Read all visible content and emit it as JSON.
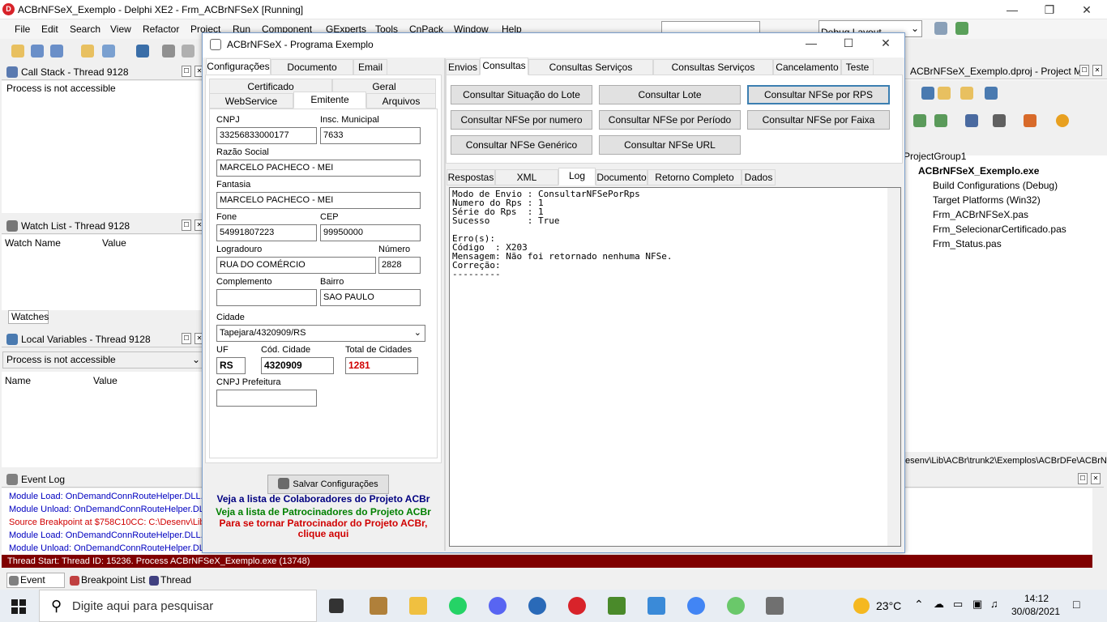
{
  "ide": {
    "title": "ACBrNFSeX_Exemplo - Delphi XE2 - Frm_ACBrNFSeX [Running]",
    "menu": [
      "File",
      "Edit",
      "Search",
      "View",
      "Refactor",
      "Project",
      "Run",
      "Component",
      "GExperts",
      "Tools",
      "CnPack",
      "Window",
      "Help"
    ],
    "layout_combo": "Debug Layout",
    "call_stack": {
      "title": "Call Stack - Thread 9128",
      "text": "Process is not accessible"
    },
    "watch_list": {
      "title": "Watch List - Thread 9128",
      "col_name": "Watch Name",
      "col_value": "Value",
      "tab": "Watches"
    },
    "local_vars": {
      "title": "Local Variables - Thread 9128",
      "combo": "Process is not accessible",
      "col_name": "Name",
      "col_value": "Value"
    },
    "project_manager": {
      "title": "ACBrNFSeX_Exemplo.dproj - Project M...",
      "group": "ProjectGroup1",
      "project": "ACBrNFSeX_Exemplo.exe",
      "items": [
        "Build Configurations (Debug)",
        "Target Platforms (Win32)",
        "Frm_ACBrNFSeX.pas",
        "Frm_SelecionarCertificado.pas",
        "Frm_Status.pas"
      ],
      "path": "esenv\\Lib\\ACBr\\trunk2\\Exemplos\\ACBrDFe\\ACBrNFS"
    },
    "event_log": {
      "title": "Event Log",
      "lines": [
        {
          "text": "Module Load: OnDemandConnRouteHelper.DLL. N",
          "color": "#0000c0"
        },
        {
          "text": "Module Unload: OnDemandConnRouteHelper.DLL.",
          "color": "#0000c0"
        },
        {
          "text": "Source Breakpoint at $758C10CC: C:\\Desenv\\Lib\\",
          "color": "#d00000"
        },
        {
          "text": "Module Load: OnDemandConnRouteHelper.DLL. N",
          "color": "#0000c0"
        },
        {
          "text": "Module Unload: OnDemandConnRouteHelper.DLL.",
          "color": "#0000c0"
        }
      ],
      "status": "Thread Start: Thread ID: 15236. Process ACBrNFSeX_Exemplo.exe (13748)"
    },
    "bottom_tabs": [
      "Event Log",
      "Breakpoint List",
      "Thread Status"
    ]
  },
  "dialog": {
    "title": "ACBrNFSeX - Programa Exemplo",
    "left_tabs": [
      "Configurações",
      "Documento Auxiliar",
      "Email"
    ],
    "sub_tabs_row1": [
      "Certificado",
      "Geral"
    ],
    "sub_tabs_row2": [
      "WebService",
      "Emitente",
      "Arquivos"
    ],
    "fields": {
      "cnpj_label": "CNPJ",
      "cnpj": "33256833000177",
      "im_label": "Insc. Municipal",
      "im": "7633",
      "razao_label": "Razão Social",
      "razao": "MARCELO PACHECO - MEI",
      "fantasia_label": "Fantasia",
      "fantasia": "MARCELO PACHECO - MEI",
      "fone_label": "Fone",
      "fone": "54991807223",
      "cep_label": "CEP",
      "cep": "99950000",
      "logradouro_label": "Logradouro",
      "logradouro": "RUA DO COMÉRCIO",
      "numero_label": "Número",
      "numero": "2828",
      "complemento_label": "Complemento",
      "complemento": "",
      "bairro_label": "Bairro",
      "bairro": "SAO PAULO",
      "cidade_label": "Cidade",
      "cidade": "Tapejara/4320909/RS",
      "uf_label": "UF",
      "uf": "RS",
      "cod_cidade_label": "Cód. Cidade",
      "cod_cidade": "4320909",
      "total_label": "Total de Cidades",
      "total": "1281",
      "cnpj_pref_label": "CNPJ Prefeitura",
      "cnpj_pref": ""
    },
    "save_button": "Salvar Configurações",
    "sponsor": {
      "line1": "Veja a lista de Colaboradores do Projeto ACBr",
      "line2": "Veja a lista de Patrocinadores do Projeto ACBr",
      "line3": "Para se tornar Patrocinador do Projeto ACBr,",
      "line4": "clique aqui"
    },
    "right_tabs": [
      "Envios",
      "Consultas",
      "Consultas Serviços Prestados",
      "Consultas Serviços Tomados",
      "Cancelamento",
      "Teste"
    ],
    "buttons": [
      "Consultar Situação do Lote",
      "Consultar Lote",
      "Consultar NFSe por RPS",
      "Consultar NFSe por numero",
      "Consultar NFSe por Período",
      "Consultar NFSe por Faixa",
      "Consultar NFSe Genérico",
      "Consultar NFSe URL"
    ],
    "result_tabs": [
      "Respostas",
      "XML Resposta",
      "Log",
      "Documento",
      "Retorno Completo WS",
      "Dados"
    ],
    "log_lines": [
      "Modo de Envio : ConsultarNFSePorRps",
      "Numero do Rps : 1",
      "Série do Rps  : 1",
      "Sucesso       : True",
      "",
      "Erro(s):",
      "Código  : X203",
      "Mensagem: Não foi retornado nenhuma NFSe.",
      "Correção:",
      "---------"
    ]
  },
  "taskbar": {
    "search": "Digite aqui para pesquisar",
    "temp": "23°C",
    "time": "14:12",
    "date": "30/08/2021"
  }
}
